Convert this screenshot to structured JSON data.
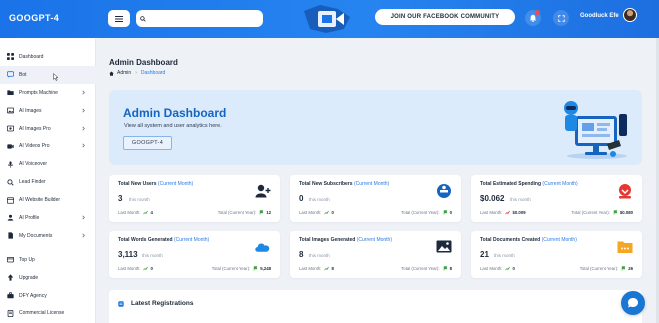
{
  "app": {
    "brand": "GOOGPT-4"
  },
  "topbar": {
    "search_placeholder": "",
    "facebook_button": "JOIN OUR FACEBOOK COMMUNITY",
    "user_name": "Goodluck Efe"
  },
  "sidebar": {
    "items": [
      {
        "label": "Dashboard",
        "icon": "grid-icon",
        "chevron": false
      },
      {
        "label": "Bot",
        "icon": "chat-icon",
        "chevron": false
      },
      {
        "label": "Prompts Machine",
        "icon": "folder-icon",
        "chevron": true
      },
      {
        "label": "AI Images",
        "icon": "image-icon",
        "chevron": true
      },
      {
        "label": "AI Images Pro",
        "icon": "image-pro-icon",
        "chevron": true
      },
      {
        "label": "AI Videos Pro",
        "icon": "video-icon",
        "chevron": true
      },
      {
        "label": "AI Voiceover",
        "icon": "voice-icon",
        "chevron": false
      },
      {
        "label": "Lead Finder",
        "icon": "lead-icon",
        "chevron": false
      },
      {
        "label": "AI Website Builder",
        "icon": "website-icon",
        "chevron": false
      },
      {
        "label": "AI Profile",
        "icon": "profile-icon",
        "chevron": true
      },
      {
        "label": "My Documents",
        "icon": "document-icon",
        "chevron": true
      },
      {
        "label": "Top Up",
        "icon": "topup-icon",
        "chevron": false
      },
      {
        "label": "Upgrade",
        "icon": "upgrade-icon",
        "chevron": false
      },
      {
        "label": "DFY Agency",
        "icon": "agency-icon",
        "chevron": false
      },
      {
        "label": "Commercial License",
        "icon": "license-icon",
        "chevron": false
      }
    ]
  },
  "page": {
    "title": "Admin Dashboard",
    "breadcrumb": {
      "home": "Admin",
      "current": "Dashboard"
    }
  },
  "hero": {
    "title": "Admin Dashboard",
    "subtitle": "View all system and user analytics here.",
    "button": "GOOGPT-4"
  },
  "cards": [
    {
      "title": "Total New Users",
      "sub": "(Current Month)",
      "value": "3",
      "period": "this month",
      "last_label": "Last Month:",
      "last_value": "4",
      "total_label": "Total (Current Year):",
      "total_value": "12",
      "icon": "user-plus-icon",
      "color": "#1e2a3b"
    },
    {
      "title": "Total New Subscribers",
      "sub": "(Current Month)",
      "value": "0",
      "period": "this month",
      "last_label": "Last Month:",
      "last_value": "0",
      "total_label": "Total (Current Year):",
      "total_value": "0",
      "icon": "subscriber-icon",
      "color": "#1565c0"
    },
    {
      "title": "Total Estimated Spending",
      "sub": "(Current Month)",
      "value": "$0.062",
      "period": "this month",
      "last_label": "Last Month:",
      "last_value": "$0.009",
      "total_label": "Total (Current Year):",
      "total_value": "$0.080",
      "icon": "money-icon",
      "color": "#e53935"
    },
    {
      "title": "Total Words Generated",
      "sub": "(Current Month)",
      "value": "3,113",
      "period": "this month",
      "last_label": "Last Month:",
      "last_value": "0",
      "total_label": "Total (Current Year):",
      "total_value": "5,248",
      "icon": "cloud-icon",
      "color": "#1e88e5"
    },
    {
      "title": "Total Images Generated",
      "sub": "(Current Month)",
      "value": "8",
      "period": "this month",
      "last_label": "Last Month:",
      "last_value": "8",
      "total_label": "Total (Current Year):",
      "total_value": "8",
      "icon": "image-icon",
      "color": "#1e2a3b"
    },
    {
      "title": "Total Documents Created",
      "sub": "(Current Month)",
      "value": "21",
      "period": "this month",
      "last_label": "Last Month:",
      "last_value": "0",
      "total_label": "Total (Current Year):",
      "total_value": "26",
      "icon": "folder-icon",
      "color": "#f5a623"
    }
  ],
  "registrations": {
    "title": "Latest Registrations"
  },
  "colors": {
    "primary": "#1a73e8",
    "accent_blue": "#2a7be4",
    "hero_bg": "#dcebfb"
  }
}
